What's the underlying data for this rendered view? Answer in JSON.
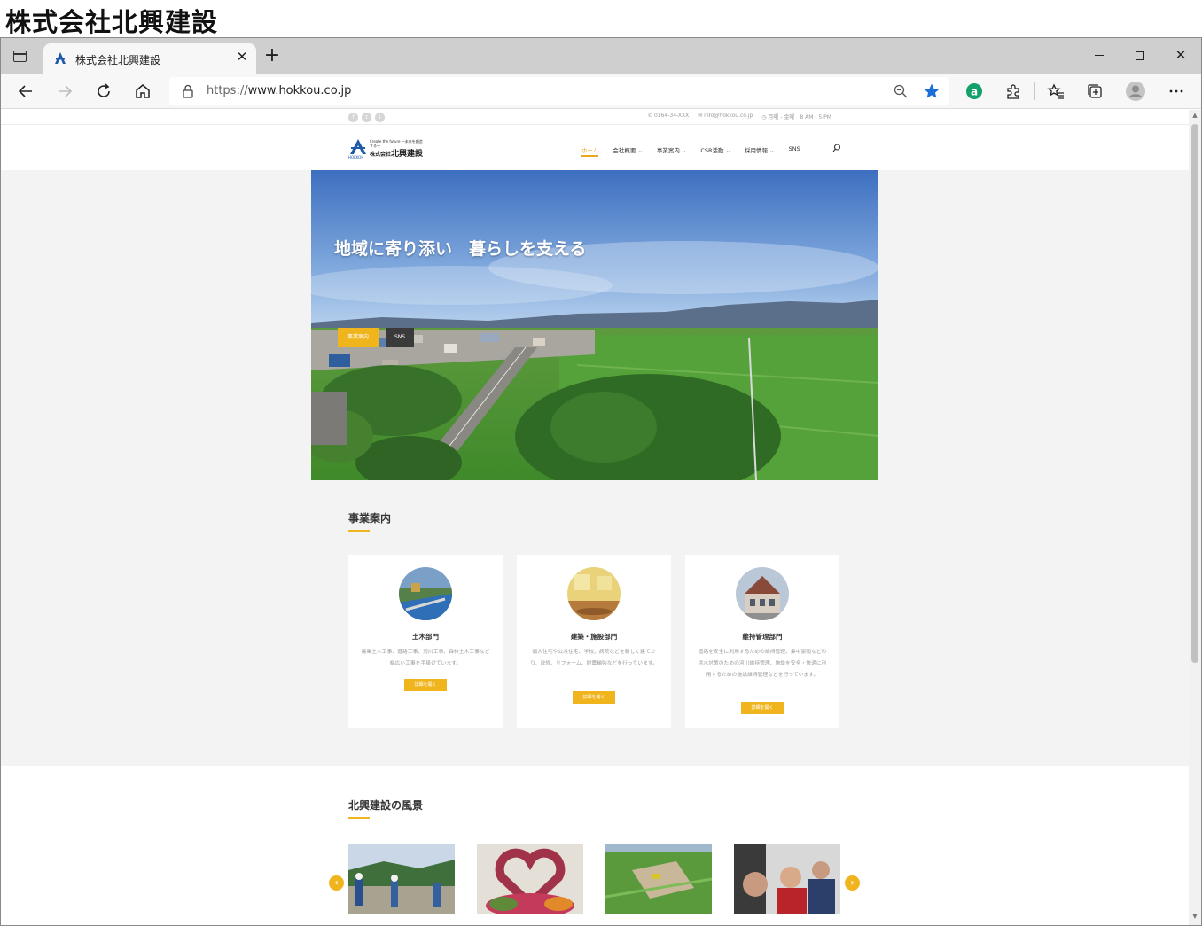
{
  "document_title": "株式会社北興建設",
  "browser": {
    "tab_title": "株式会社北興建設",
    "url_scheme": "https://",
    "url_host": "www.hokkou.co.jp",
    "extension_badge": "a"
  },
  "site": {
    "topbar": {
      "social": [
        "f",
        "t",
        "i"
      ],
      "phone": "0164-34-XXX",
      "email": "info@hokkou.co.jp",
      "hours": "月曜 - 金曜　8 AM - 5 PM"
    },
    "logo": {
      "tagline": "Create the future ～未来を創造する～",
      "name_prefix": "株式会社",
      "name": "北興建設",
      "sub": "HOKKOH"
    },
    "nav": [
      {
        "label": "ホーム"
      },
      {
        "label": "会社概要 ⌄"
      },
      {
        "label": "事業案内 ⌄"
      },
      {
        "label": "CSR活動 ⌄"
      },
      {
        "label": "採用情報 ⌄"
      },
      {
        "label": "SNS"
      }
    ],
    "hero": {
      "title": "地域に寄り添い　暮らしを支える",
      "btn_primary": "事業案内",
      "btn_secondary": "SNS"
    },
    "business": {
      "title": "事業案内",
      "cards": [
        {
          "title": "土木部門",
          "desc": "農業土木工事、道路工事、河川工事、森林土木工事など幅広い工事を手掛けています。",
          "button": "詳細を開く"
        },
        {
          "title": "建築・施設部門",
          "desc": "個人住宅や公共住宅、学校、病院などを新しく建てたり、改修、リフォーム、耐震補強などを行っています。",
          "button": "詳細を開く"
        },
        {
          "title": "維持管理部門",
          "desc": "道路を安全に利用するための維持管理、集中豪雨などの洪水対策のための河川維持管理、施設を安全・快適に利用するための施設維持管理などを行っています。",
          "button": "詳細を開く"
        }
      ]
    },
    "scenery": {
      "title": "北興建設の風景",
      "prev": "‹",
      "next": "›"
    }
  },
  "colors": {
    "accent": "#f0b41c",
    "dark_button": "#3a3a3a",
    "section_bg": "#f3f3f3"
  }
}
